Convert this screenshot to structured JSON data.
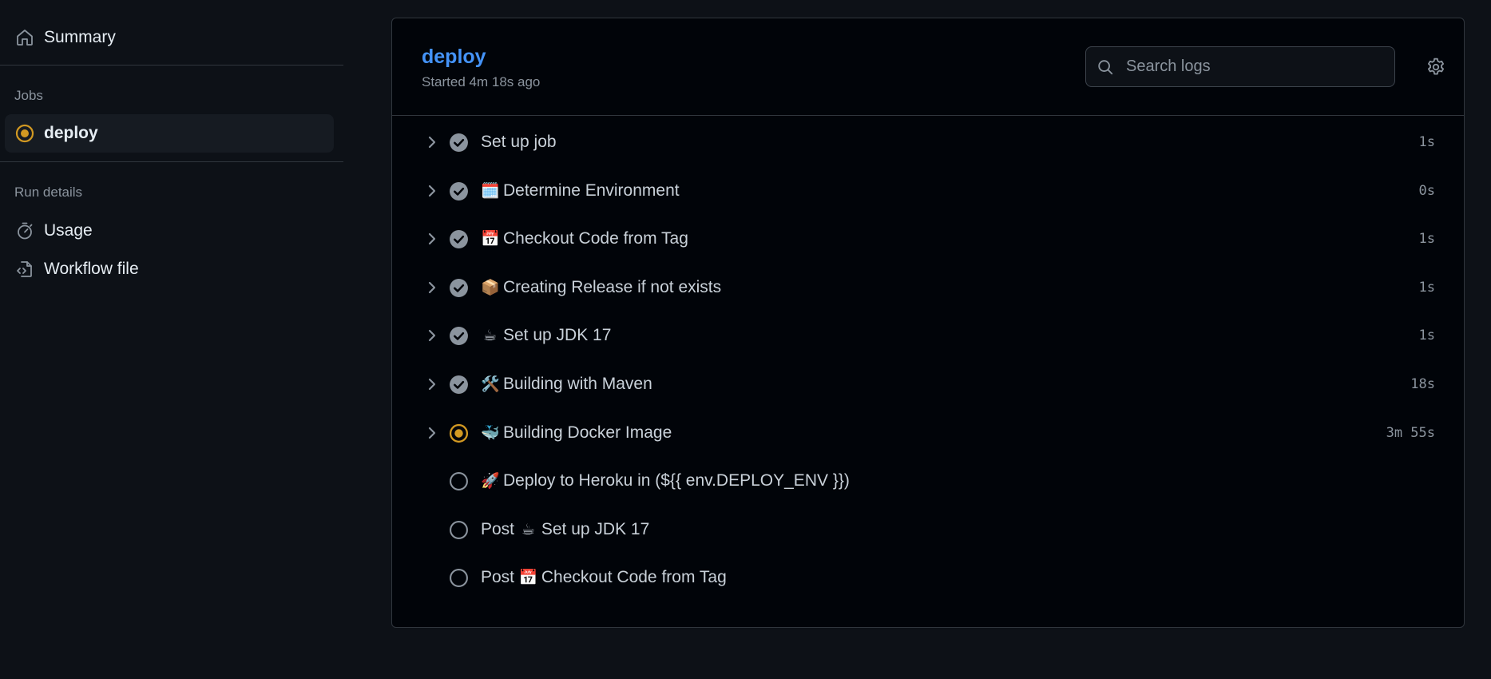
{
  "sidebar": {
    "summary_label": "Summary",
    "jobs_heading": "Jobs",
    "job_label": "deploy",
    "run_details_heading": "Run details",
    "usage_label": "Usage",
    "workflow_file_label": "Workflow file"
  },
  "job": {
    "title": "deploy",
    "started": "Started 4m 18s ago"
  },
  "search": {
    "placeholder": "Search logs",
    "value": ""
  },
  "colors": {
    "accent": "#4493f8",
    "in_progress": "#d29922",
    "success_gray": "#8b949e",
    "pending": "#8b949e"
  },
  "steps": [
    {
      "prefix": "",
      "emoji": "",
      "name": "Set up job",
      "duration": "1s",
      "status": "success",
      "expandable": true
    },
    {
      "prefix": "",
      "emoji": "🗓️",
      "name": "Determine Environment",
      "duration": "0s",
      "status": "success",
      "expandable": true
    },
    {
      "prefix": "",
      "emoji": "📅",
      "name": "Checkout Code from Tag",
      "duration": "1s",
      "status": "success",
      "expandable": true
    },
    {
      "prefix": "",
      "emoji": "📦",
      "name": "Creating Release if not exists",
      "duration": "1s",
      "status": "success",
      "expandable": true
    },
    {
      "prefix": "",
      "emoji": "☕",
      "name": "Set up JDK 17",
      "duration": "1s",
      "status": "success",
      "expandable": true
    },
    {
      "prefix": "",
      "emoji": "🛠️",
      "name": "Building with Maven",
      "duration": "18s",
      "status": "success",
      "expandable": true
    },
    {
      "prefix": "",
      "emoji": "🐳",
      "name": "Building Docker Image",
      "duration": "3m 55s",
      "status": "in-progress",
      "expandable": true
    },
    {
      "prefix": "",
      "emoji": "🚀",
      "name": "Deploy to Heroku in (${{ env.DEPLOY_ENV }})",
      "duration": "",
      "status": "pending",
      "expandable": false
    },
    {
      "prefix": "Post ",
      "emoji": "☕",
      "name": "Set up JDK 17",
      "duration": "",
      "status": "pending",
      "expandable": false
    },
    {
      "prefix": "Post ",
      "emoji": "📅",
      "name": "Checkout Code from Tag",
      "duration": "",
      "status": "pending",
      "expandable": false
    }
  ]
}
